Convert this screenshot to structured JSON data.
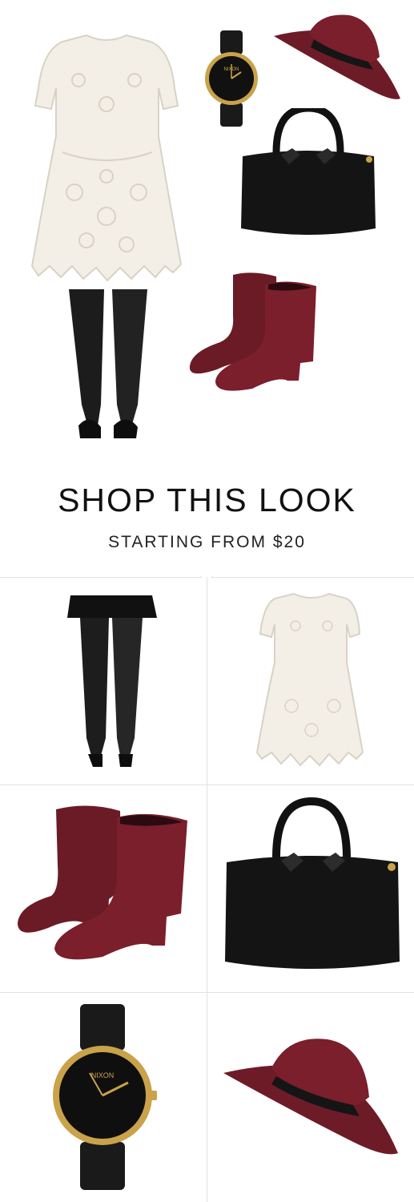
{
  "shop": {
    "heading": "SHOP THIS LOOK",
    "subheading": "STARTING FROM $20"
  },
  "watch": {
    "brand": "NIXON"
  },
  "items": [
    {
      "name": "black tights with skirt",
      "icon": "tights-icon"
    },
    {
      "name": "white lace dress",
      "icon": "dress-icon"
    },
    {
      "name": "burgundy ankle boots",
      "icon": "boots-icon"
    },
    {
      "name": "black leather bag",
      "icon": "bag-icon"
    },
    {
      "name": "gold black watch",
      "icon": "watch-icon"
    },
    {
      "name": "burgundy wide brim hat",
      "icon": "hat-icon"
    }
  ],
  "colors": {
    "burgundy": "#7a1f2b",
    "black": "#151515",
    "lace": "#f2eee6",
    "gold": "#c9a24a"
  }
}
